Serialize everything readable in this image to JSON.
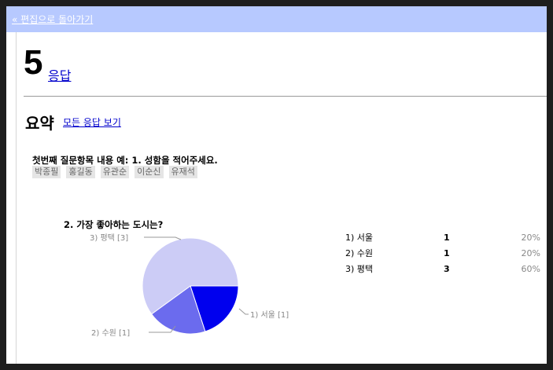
{
  "nav": {
    "back_label": "« 편집으로 돌아가기"
  },
  "header": {
    "count": "5",
    "count_label": "응답"
  },
  "summary": {
    "title": "요약",
    "view_all_label": "모든 응답 보기"
  },
  "question1": {
    "title": "첫번째 질문항목 내용 예: 1. 성함을 적어주세요.",
    "answers": [
      "박종필",
      "홍길동",
      "유관순",
      "이순신",
      "유재석"
    ]
  },
  "question2": {
    "title": "2. 가장 좋아하는 도시는?",
    "pie_labels": [
      "1) 서울 [1]",
      "2) 수원 [1]",
      "3) 평택 [3]"
    ],
    "rows": [
      {
        "label": "1) 서울",
        "count": "1",
        "percent": "20%"
      },
      {
        "label": "2) 수원",
        "count": "1",
        "percent": "20%"
      },
      {
        "label": "3) 평택",
        "count": "3",
        "percent": "60%"
      }
    ]
  },
  "chart_data": {
    "type": "pie",
    "categories": [
      "1) 서울",
      "2) 수원",
      "3) 평택"
    ],
    "values": [
      1,
      1,
      3
    ],
    "colors": [
      "#0000ee",
      "#6b6bee",
      "#ccccf6"
    ],
    "title": "2. 가장 좋아하는 도시는?"
  }
}
